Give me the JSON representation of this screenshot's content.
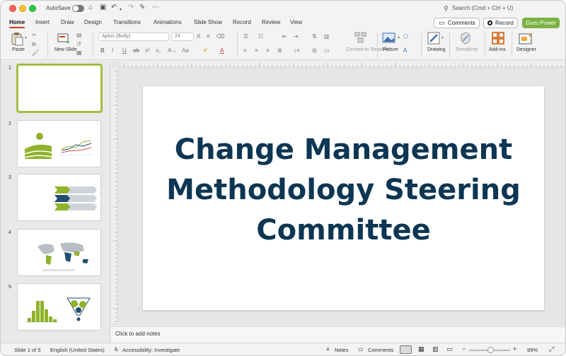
{
  "titlebar": {
    "autosave_label": "AutoSave",
    "autosave_on": false,
    "search_placeholder": "Search (Cmd + Ctrl + U)"
  },
  "tabs": [
    "Home",
    "Insert",
    "Draw",
    "Design",
    "Transitions",
    "Animations",
    "Slide Show",
    "Record",
    "Review",
    "View"
  ],
  "active_tab": "Home",
  "header_buttons": {
    "comments": "Comments",
    "record": "Record",
    "guru": "Guru Power"
  },
  "ribbon": {
    "paste": "Paste",
    "new_slide": "New Slide",
    "font_name": "Aptos (Body)",
    "font_size": "24",
    "convert_smartart": "Convert to SmartArt",
    "picture": "Picture",
    "drawing": "Drawing",
    "sensitivity": "Sensitivity",
    "addins": "Add-ins",
    "designer": "Designer"
  },
  "thumbnails": [
    {
      "num": "1",
      "selected": true
    },
    {
      "num": "2",
      "selected": false
    },
    {
      "num": "3",
      "selected": false
    },
    {
      "num": "4",
      "selected": false
    },
    {
      "num": "5",
      "selected": false
    }
  ],
  "slide": {
    "title_line1": "Change Management",
    "title_line2": "Methodology Steering",
    "title_line3": "Committee",
    "title_color": "#0c3653"
  },
  "notes_placeholder": "Click to add notes",
  "status": {
    "slide_info": "Slide 1 of 5",
    "language": "English (United States)",
    "accessibility": "Accessibility: Investigate",
    "notes": "Notes",
    "comments": "Comments",
    "zoom": "99%",
    "zoom_fraction": 0.5
  },
  "colors": {
    "accent_tab": "#c43e1c",
    "guru_button": "#7cb342",
    "thumbnail_selected": "#a2bd44",
    "chart_green": "#8fb32a",
    "chart_navy": "#1f4e6e"
  }
}
